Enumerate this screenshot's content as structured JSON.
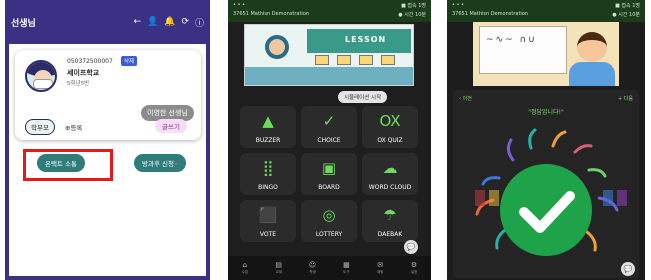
{
  "phone1": {
    "title": "선생님",
    "student": {
      "phone": "050372500007",
      "delete_label": "삭제",
      "school": "세이프학교",
      "grade": "5학년5반"
    },
    "teacher_name": "이영한 선생님",
    "parent_label": "학부모",
    "register_label": "등록",
    "write_label": "글쓰기",
    "contact_label": "온택트 소통",
    "after_school_label": "방과후 신청",
    "colors": {
      "header": "#3a3185",
      "highlight": "#e41a1a",
      "button": "#2e7d7a"
    }
  },
  "phone2": {
    "status": {
      "left_top": "• • •",
      "left_bottom": "37651 Mathisn Demonstration",
      "right_top": "■ 접속 1명",
      "right_bottom": "● 시간 10분"
    },
    "lesson_text": "LESSON",
    "start_label": "시뮬레이션 시작",
    "tiles": [
      {
        "label": "BUZZER",
        "icon": "buzzer-icon",
        "glyph": "▲"
      },
      {
        "label": "CHOICE",
        "icon": "choice-icon",
        "glyph": "✓"
      },
      {
        "label": "OX QUIZ",
        "icon": "ox-quiz-icon",
        "glyph": "OX"
      },
      {
        "label": "BINGO",
        "icon": "bingo-icon",
        "glyph": "⣿"
      },
      {
        "label": "BOARD",
        "icon": "board-icon",
        "glyph": "▣"
      },
      {
        "label": "WORD CLOUD",
        "icon": "word-cloud-icon",
        "glyph": "☁"
      },
      {
        "label": "VOTE",
        "icon": "vote-icon",
        "glyph": "⬛"
      },
      {
        "label": "LOTTERY",
        "icon": "lottery-icon",
        "glyph": "◎"
      },
      {
        "label": "DAEBAK",
        "icon": "daebak-icon",
        "glyph": "☂"
      }
    ],
    "nav": [
      {
        "icon": "home-icon",
        "glyph": "⌂",
        "label": "수업"
      },
      {
        "icon": "book-icon",
        "glyph": "▤",
        "label": "교재"
      },
      {
        "icon": "people-icon",
        "glyph": "☺",
        "label": "학생"
      },
      {
        "icon": "grid-icon",
        "glyph": "▦",
        "label": "도구"
      },
      {
        "icon": "chat-icon",
        "glyph": "✉",
        "label": "채팅"
      },
      {
        "icon": "settings-icon",
        "glyph": "⚙",
        "label": "설정"
      }
    ]
  },
  "phone3": {
    "status": {
      "left_top": "• • •",
      "left_bottom": "37651 Mathisn Demonstration",
      "right_top": "■ 접속 1명",
      "right_bottom": "● 시간 10분"
    },
    "back_label": "‹ 이전",
    "plus_label": "+ 다음",
    "answer_label": "\"정답입니다!\"",
    "colors": {
      "check": "#1fa34a",
      "accent": "#8cd97a"
    }
  }
}
